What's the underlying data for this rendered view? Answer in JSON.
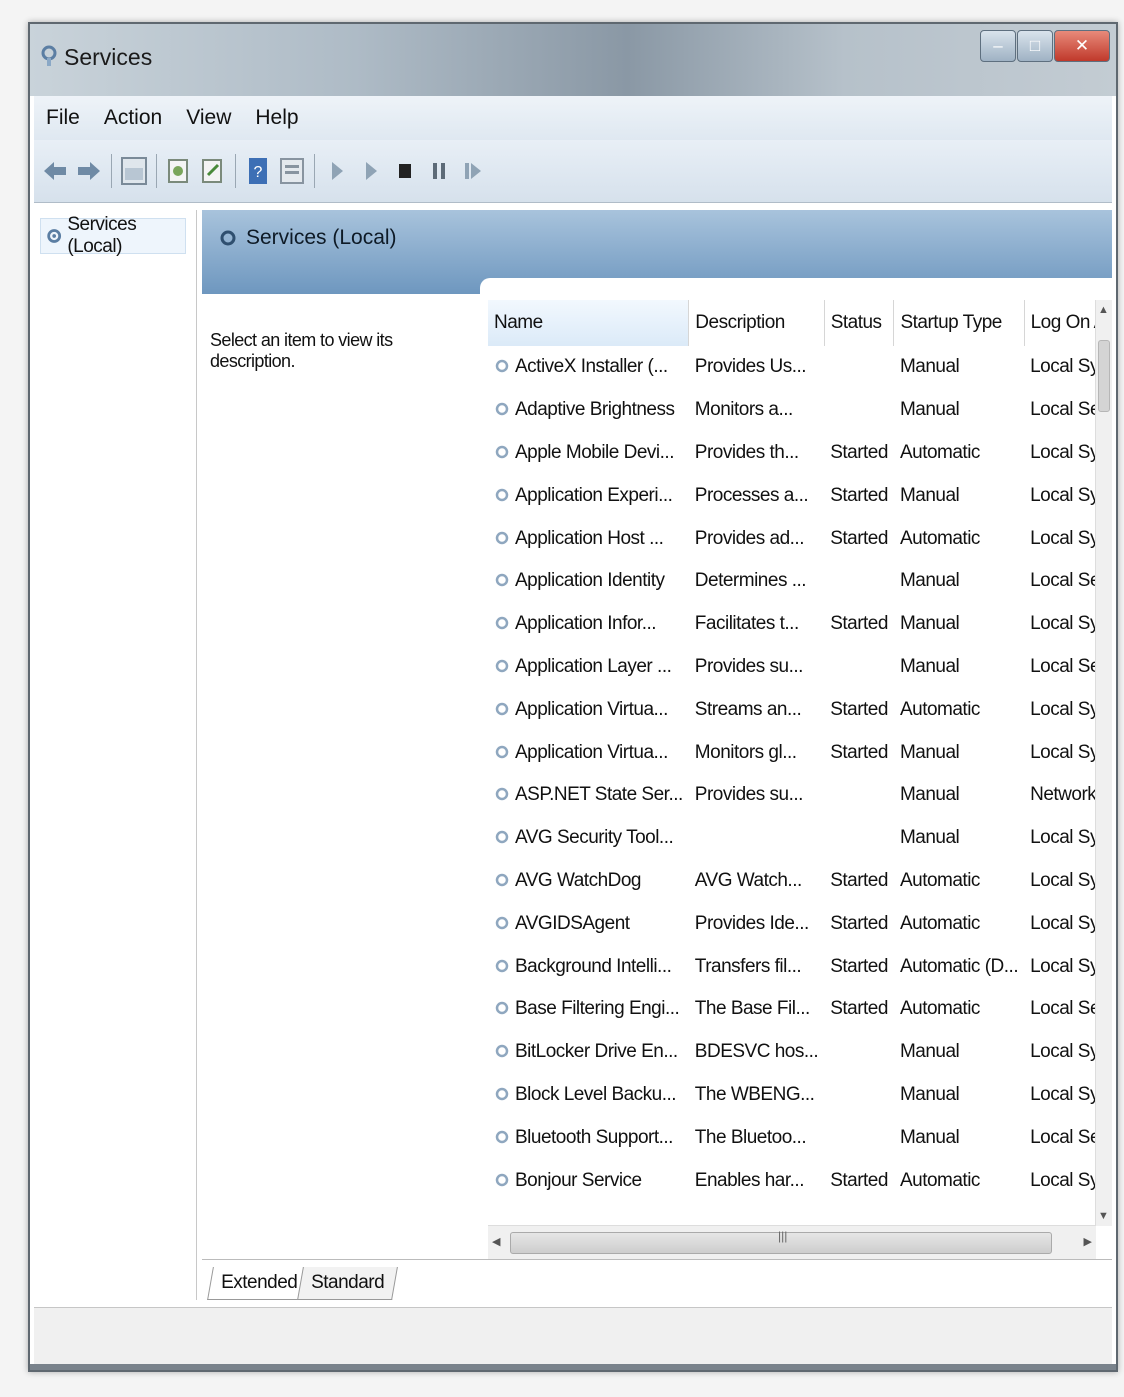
{
  "window": {
    "title": "Services"
  },
  "menu": [
    "File",
    "Action",
    "View",
    "Help"
  ],
  "toolbar": {
    "icons": [
      "back-icon",
      "forward-icon",
      "show-hide-tree-icon",
      "export-icon",
      "refresh-icon",
      "help-icon",
      "properties-icon",
      "start-service-icon",
      "start-service-2-icon",
      "stop-service-icon",
      "pause-service-icon",
      "resume-service-icon"
    ]
  },
  "tree": {
    "root_label": "Services (Local)"
  },
  "main": {
    "header_title": "Services (Local)",
    "description_prompt": "Select an item to view its description.",
    "columns": [
      "Name",
      "Description",
      "Status",
      "Startup Type",
      "Log On As"
    ],
    "rows": [
      [
        "ActiveX Installer (...",
        "Provides Us...",
        "",
        "Manual",
        "Local Syste..."
      ],
      [
        "Adaptive Brightness",
        "Monitors a...",
        "",
        "Manual",
        "Local Service"
      ],
      [
        "Apple Mobile Devi...",
        "Provides th...",
        "Started",
        "Automatic",
        "Local Syste..."
      ],
      [
        "Application Experi...",
        "Processes a...",
        "Started",
        "Manual",
        "Local Syste..."
      ],
      [
        "Application Host ...",
        "Provides ad...",
        "Started",
        "Automatic",
        "Local Syste..."
      ],
      [
        "Application Identity",
        "Determines ...",
        "",
        "Manual",
        "Local Service"
      ],
      [
        "Application Infor...",
        "Facilitates t...",
        "Started",
        "Manual",
        "Local Syste..."
      ],
      [
        "Application Layer ...",
        "Provides su...",
        "",
        "Manual",
        "Local Service"
      ],
      [
        "Application Virtua...",
        "Streams an...",
        "Started",
        "Automatic",
        "Local Syste..."
      ],
      [
        "Application Virtua...",
        "Monitors gl...",
        "Started",
        "Manual",
        "Local Syste..."
      ],
      [
        "ASP.NET State Ser...",
        "Provides su...",
        "",
        "Manual",
        "Network S..."
      ],
      [
        "AVG Security Tool...",
        "",
        "",
        "Manual",
        "Local Syste..."
      ],
      [
        "AVG WatchDog",
        "AVG Watch...",
        "Started",
        "Automatic",
        "Local Syste..."
      ],
      [
        "AVGIDSAgent",
        "Provides Ide...",
        "Started",
        "Automatic",
        "Local Syste..."
      ],
      [
        "Background Intelli...",
        "Transfers fil...",
        "Started",
        "Automatic (D...",
        "Local Syste..."
      ],
      [
        "Base Filtering Engi...",
        "The Base Fil...",
        "Started",
        "Automatic",
        "Local Service"
      ],
      [
        "BitLocker Drive En...",
        "BDESVC hos...",
        "",
        "Manual",
        "Local Syste..."
      ],
      [
        "Block Level Backu...",
        "The WBENG...",
        "",
        "Manual",
        "Local Syste..."
      ],
      [
        "Bluetooth Support...",
        "The Bluetoo...",
        "",
        "Manual",
        "Local Service"
      ],
      [
        "Bonjour Service",
        "Enables har...",
        "Started",
        "Automatic",
        "Local Syste..."
      ]
    ]
  },
  "tabs": [
    "Extended",
    "Standard"
  ],
  "colors": {
    "header_band": "#7fa3c7",
    "title_bar": "#aebbc6",
    "close_button": "#c0392b"
  }
}
